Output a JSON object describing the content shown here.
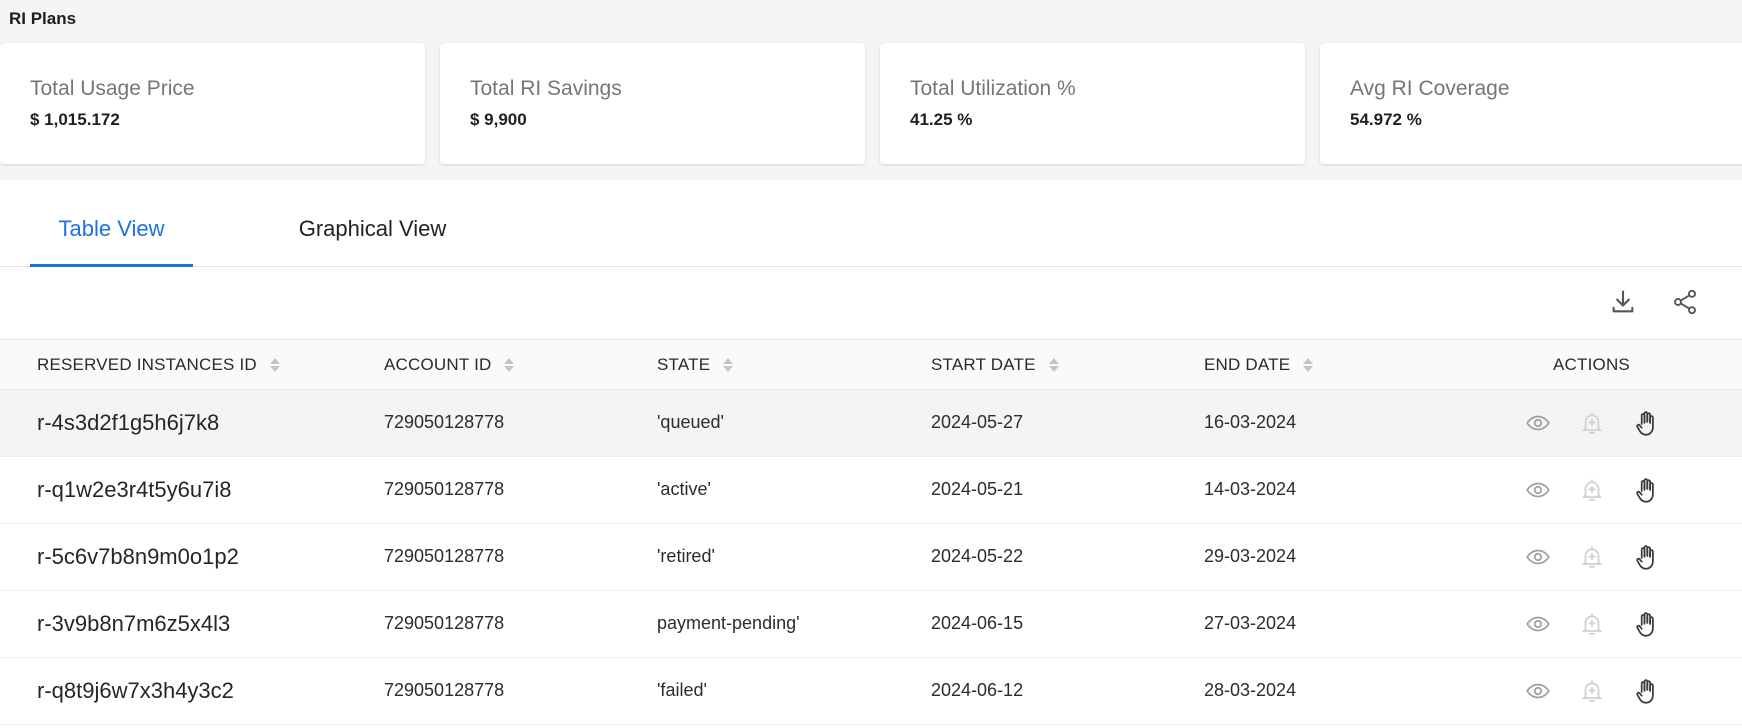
{
  "page_title": "RI Plans",
  "cards": [
    {
      "label": "Total Usage Price",
      "value": "$ 1,015.172"
    },
    {
      "label": "Total RI Savings",
      "value": "$ 9,900"
    },
    {
      "label": "Total Utilization %",
      "value": "41.25 %"
    },
    {
      "label": "Avg RI Coverage",
      "value": "54.972 %"
    }
  ],
  "tabs": [
    {
      "label": "Table View",
      "active": true
    },
    {
      "label": "Graphical View",
      "active": false
    }
  ],
  "toolbar": {
    "download_icon": "download-icon",
    "share_icon": "share-icon"
  },
  "table": {
    "columns": [
      "RESERVED INSTANCES ID",
      "ACCOUNT ID",
      "STATE",
      "START DATE",
      "END DATE",
      "ACTIONS"
    ],
    "rows": [
      {
        "id": "r-4s3d2f1g5h6j7k8",
        "account": "729050128778",
        "state": "'queued'",
        "start": "2024-05-27",
        "end": "16-03-2024"
      },
      {
        "id": "r-q1w2e3r4t5y6u7i8",
        "account": "729050128778",
        "state": "'active'",
        "start": "2024-05-21",
        "end": "14-03-2024"
      },
      {
        "id": "r-5c6v7b8n9m0o1p2",
        "account": "729050128778",
        "state": "'retired'",
        "start": "2024-05-22",
        "end": "29-03-2024"
      },
      {
        "id": "r-3v9b8n7m6z5x4l3",
        "account": "729050128778",
        "state": "payment-pending'",
        "start": "2024-06-15",
        "end": "27-03-2024"
      },
      {
        "id": "r-q8t9j6w7x3h4y3c2",
        "account": "729050128778",
        "state": "'failed'",
        "start": "2024-06-12",
        "end": "28-03-2024"
      }
    ]
  },
  "colors": {
    "accent": "#1f6fe5",
    "icon_gray": "#9e9e9e",
    "icon_light": "#cfcfcf",
    "icon_dark": "#3a3a3a"
  }
}
